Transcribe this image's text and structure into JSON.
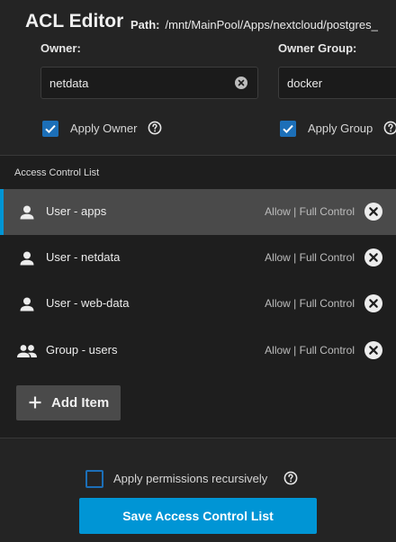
{
  "header": {
    "title": "ACL Editor",
    "path_label": "Path:",
    "path_value": "/mnt/MainPool/Apps/nextcloud/postgres_"
  },
  "owner": {
    "label": "Owner:",
    "value": "netdata",
    "apply_label": "Apply Owner",
    "apply_checked": true
  },
  "owner_group": {
    "label": "Owner Group:",
    "value": "docker",
    "apply_label": "Apply Group",
    "apply_checked": true
  },
  "acl": {
    "title": "Access Control List",
    "items": [
      {
        "label": "User - apps",
        "permission": "Allow | Full Control",
        "icon": "user-icon",
        "selected": true
      },
      {
        "label": "User - netdata",
        "permission": "Allow | Full Control",
        "icon": "user-icon",
        "selected": false
      },
      {
        "label": "User - web-data",
        "permission": "Allow | Full Control",
        "icon": "user-icon",
        "selected": false
      },
      {
        "label": "Group - users",
        "permission": "Allow | Full Control",
        "icon": "group-icon",
        "selected": false
      }
    ],
    "add_label": "Add Item"
  },
  "footer": {
    "recursive_label": "Apply permissions recursively",
    "recursive_checked": false,
    "save_label": "Save Access Control List"
  },
  "colors": {
    "accent": "#0095d5",
    "checkbox": "#1c6fb8",
    "background": "#1e1e1e",
    "selected_row": "#4a4a4a"
  }
}
